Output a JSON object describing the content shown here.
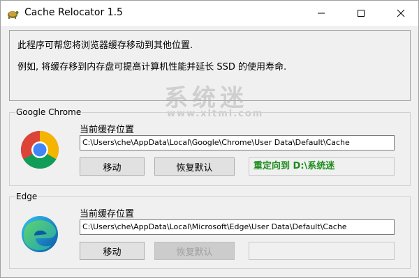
{
  "window": {
    "title": "Cache Relocator 1.5",
    "app_icon": "cache-relocator-turtle-icon"
  },
  "titlebar_buttons": {
    "minimize_icon": "minimize-icon",
    "maximize_icon": "maximize-icon",
    "close_icon": "close-icon"
  },
  "description": {
    "line1": "此程序可帮您将浏览器缓存移动到其他位置.",
    "line2": "例如, 将缓存移到内存盘可提高计算机性能并延长 SSD 的使用寿命."
  },
  "watermark": {
    "text": "系统迷",
    "url": "www.xitmi.com"
  },
  "chrome": {
    "group_label": "Google Chrome",
    "icon": "chrome-icon",
    "path_label": "当前缓存位置",
    "path_value": "C:\\Users\\che\\AppData\\Local\\Google\\Chrome\\User Data\\Default\\Cache",
    "move_label": "移动",
    "restore_label": "恢复默认",
    "status_text": "重定向到 D:\\系统迷",
    "status_color": "#1a8c1a"
  },
  "edge": {
    "group_label": "Edge",
    "icon": "edge-icon",
    "path_label": "当前缓存位置",
    "path_value": "C:\\Users\\che\\AppData\\Local\\Microsoft\\Edge\\User Data\\Default\\Cache",
    "move_label": "移动",
    "restore_label": "恢复默认",
    "restore_disabled": true,
    "status_text": ""
  }
}
